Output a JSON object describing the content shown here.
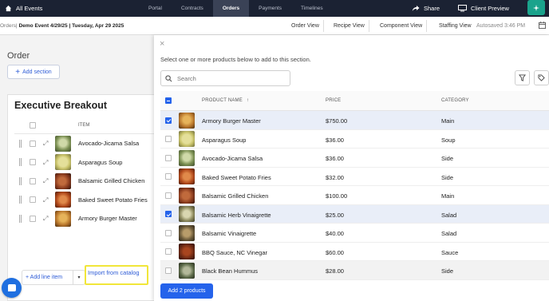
{
  "nav": {
    "home_label": "All Events",
    "tabs": [
      {
        "label": "Portal",
        "active": false
      },
      {
        "label": "Contracts",
        "active": false
      },
      {
        "label": "Orders",
        "active": true
      },
      {
        "label": "Payments",
        "active": false
      },
      {
        "label": "Timelines",
        "active": false
      }
    ],
    "share_label": "Share",
    "preview_label": "Client Preview"
  },
  "subbar": {
    "crumb_root": "Orders",
    "crumb_sep": " | ",
    "crumb_event": "Demo Event 4/29/25 | Tuesday, Apr 29 2025",
    "views": [
      "Order View",
      "Recipe View",
      "Component View",
      "Staffing View"
    ],
    "autosaved": "Autosaved 3:46 PM"
  },
  "left": {
    "order_title": "Order",
    "add_section_label": "Add section",
    "section_title": "Executive Breakout",
    "item_header": "ITEM",
    "items": [
      {
        "name": "Avocado-Jicama Salsa",
        "color": "#7a8f52"
      },
      {
        "name": "Asparagus Soup",
        "color": "#c9c36a"
      },
      {
        "name": "Balsamic Grilled Chicken",
        "color": "#8a3b1e"
      },
      {
        "name": "Baked Sweet Potato Fries",
        "color": "#b24a1c"
      },
      {
        "name": "Armory Burger Master",
        "color": "#b8762c"
      }
    ],
    "add_line_label": "+ Add line item",
    "import_label": "Import from catalog"
  },
  "panel": {
    "instruction": "Select one or more products below to add to this section.",
    "search_placeholder": "Search",
    "columns": {
      "name": "PRODUCT NAME",
      "price": "PRICE",
      "category": "CATEGORY"
    },
    "products": [
      {
        "name": "Armory Burger Master",
        "price": "$750.00",
        "category": "Main",
        "checked": true,
        "color": "#b8762c"
      },
      {
        "name": "Asparagus Soup",
        "price": "$36.00",
        "category": "Soup",
        "checked": false,
        "color": "#c9c36a"
      },
      {
        "name": "Avocado-Jicama Salsa",
        "price": "$36.00",
        "category": "Side",
        "checked": false,
        "color": "#7a8f52"
      },
      {
        "name": "Baked Sweet Potato Fries",
        "price": "$32.00",
        "category": "Side",
        "checked": false,
        "color": "#b24a1c"
      },
      {
        "name": "Balsamic Grilled Chicken",
        "price": "$100.00",
        "category": "Main",
        "checked": false,
        "color": "#8a3b1e"
      },
      {
        "name": "Balsamic Herb Vinaigrette",
        "price": "$25.00",
        "category": "Salad",
        "checked": true,
        "color": "#8d8a5e"
      },
      {
        "name": "Balsamic Vinaigrette",
        "price": "$40.00",
        "category": "Salad",
        "checked": false,
        "color": "#6b5a3a"
      },
      {
        "name": "BBQ Sauce, NC Vinegar",
        "price": "$60.00",
        "category": "Sauce",
        "checked": false,
        "color": "#6e2a14"
      },
      {
        "name": "Black Bean Hummus",
        "price": "$28.00",
        "category": "Side",
        "checked": false,
        "color": "#5d6b4a"
      }
    ],
    "add_button_label": "Add 2 products"
  },
  "colors": {
    "nav_bg": "#1b2233",
    "accent": "#2563eb",
    "teal": "#1aa38c",
    "highlight": "#f1e63a"
  }
}
